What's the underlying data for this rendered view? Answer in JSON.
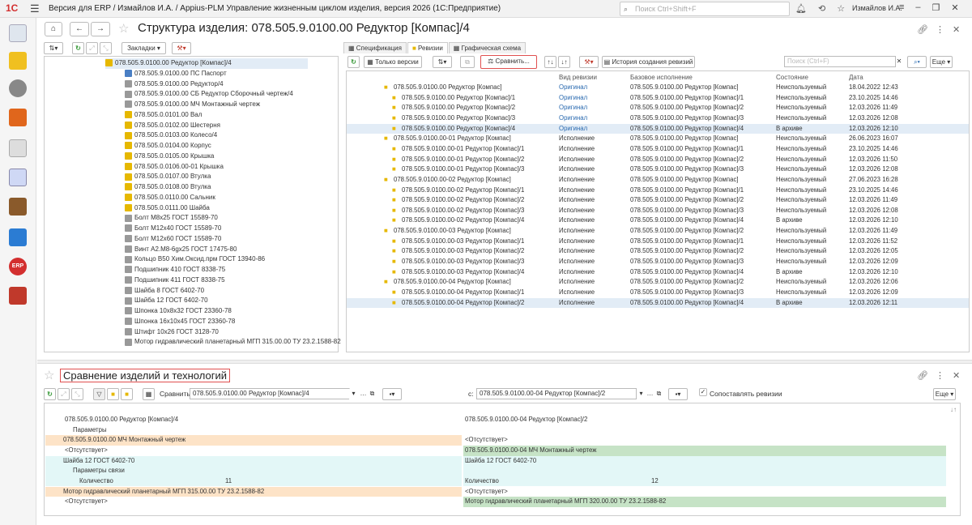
{
  "window": {
    "app_title": "Версия для ERP / Измайлов И.А. / Appius-PLM Управление жизненным циклом изделия, версия 2026  (1С:Предприятие)",
    "search_placeholder": "Поиск Ctrl+Shift+F",
    "user": "Измайлов И.А."
  },
  "main": {
    "title": "Структура изделия: 078.505.9.0100.00 Редуктор [Компас]/4",
    "bookmarks_label": "Закладки",
    "tabs": [
      "Спецификация",
      "Ревизии",
      "Графическая схема"
    ],
    "toolbar": {
      "only_versions": "Только версии",
      "compare": "Сравнить...",
      "history": "История создания ревизий",
      "search_placeholder": "Поиск (Ctrl+F)",
      "more": "Еще"
    },
    "columns": [
      "Вид ревизии",
      "Базовое исполнение",
      "Состояние",
      "Дата"
    ]
  },
  "tree": [
    "078.505.9.0100.00 Редуктор [Компас]/4",
    "078.505.9.0100.00 ПС Паспорт",
    "078.505.9.0100.00 Редуктор/4",
    "078.505.9.0100.00 СБ Редуктор Сборочный чертеж/4",
    "078.505.9.0100.00 МЧ Монтажный чертеж",
    "078.505.0.0101.00 Вал",
    "078.505.0.0102.00 Шестерня",
    "078.505.0.0103.00 Колесо/4",
    "078.505.0.0104.00 Корпус",
    "078.505.0.0105.00 Крышка",
    "078.505.0.0106.00-01 Крышка",
    "078.505.0.0107.00 Втулка",
    "078.505.0.0108.00 Втулка",
    "078.505.0.0110.00 Сальник",
    "078.505.0.0111.00 Шайба",
    "Болт М8x25 ГОСТ 15589-70",
    "Болт М12x40 ГОСТ 15589-70",
    "Болт М12x60 ГОСТ 15589-70",
    "Винт А2.М8-6gx25 ГОСТ 17475-80",
    "Кольцо B50 Хим.Оксид.прм ГОСТ 13940-86",
    "Подшипник 410  ГОСТ 8338-75",
    "Подшипник 411 ГОСТ 8338-75",
    "Шайба 8 ГОСТ 6402-70",
    "Шайба 12 ГОСТ 6402-70",
    "Шпонка 10x8x32 ГОСТ 23360-78",
    "Шпонка 16x10x45 ГОСТ 23360-78",
    "Штифт 10x26 ГОСТ 3128-70",
    "Мотор гидравлический планетарный МГП 315.00.00 ТУ 23.2.1588-82"
  ],
  "revisions": [
    {
      "name": "078.505.9.0100.00 Редуктор [Компас]",
      "kind": "Оригинал",
      "base": "078.505.9.0100.00 Редуктор [Компас]",
      "state": "Неиспользуемый",
      "date": "18.04.2022 12:43"
    },
    {
      "name": "078.505.9.0100.00 Редуктор [Компас]/1",
      "kind": "Оригинал",
      "base": "078.505.9.0100.00 Редуктор [Компас]/1",
      "state": "Неиспользуемый",
      "date": "23.10.2025 14:46"
    },
    {
      "name": "078.505.9.0100.00 Редуктор [Компас]/2",
      "kind": "Оригинал",
      "base": "078.505.9.0100.00 Редуктор [Компас]/2",
      "state": "Неиспользуемый",
      "date": "12.03.2026 11:49"
    },
    {
      "name": "078.505.9.0100.00 Редуктор [Компас]/3",
      "kind": "Оригинал",
      "base": "078.505.9.0100.00 Редуктор [Компас]/3",
      "state": "Неиспользуемый",
      "date": "12.03.2026 12:08"
    },
    {
      "name": "078.505.9.0100.00 Редуктор [Компас]/4",
      "kind": "Оригинал",
      "base": "078.505.9.0100.00 Редуктор [Компас]/4",
      "state": "В архиве",
      "date": "12.03.2026 12:10"
    },
    {
      "name": "078.505.9.0100.00-01 Редуктор [Компас]",
      "kind": "Исполнение",
      "base": "078.505.9.0100.00 Редуктор [Компас]",
      "state": "Неиспользуемый",
      "date": "26.06.2023 16:07"
    },
    {
      "name": "078.505.9.0100.00-01 Редуктор [Компас]/1",
      "kind": "Исполнение",
      "base": "078.505.9.0100.00 Редуктор [Компас]/1",
      "state": "Неиспользуемый",
      "date": "23.10.2025 14:46"
    },
    {
      "name": "078.505.9.0100.00-01 Редуктор [Компас]/2",
      "kind": "Исполнение",
      "base": "078.505.9.0100.00 Редуктор [Компас]/2",
      "state": "Неиспользуемый",
      "date": "12.03.2026 11:50"
    },
    {
      "name": "078.505.9.0100.00-01 Редуктор [Компас]/3",
      "kind": "Исполнение",
      "base": "078.505.9.0100.00 Редуктор [Компас]/3",
      "state": "Неиспользуемый",
      "date": "12.03.2026 12:08"
    },
    {
      "name": "078.505.9.0100.00-02 Редуктор [Компас]",
      "kind": "Исполнение",
      "base": "078.505.9.0100.00 Редуктор [Компас]",
      "state": "Неиспользуемый",
      "date": "27.06.2023 16:28"
    },
    {
      "name": "078.505.9.0100.00-02 Редуктор [Компас]/1",
      "kind": "Исполнение",
      "base": "078.505.9.0100.00 Редуктор [Компас]/1",
      "state": "Неиспользуемый",
      "date": "23.10.2025 14:46"
    },
    {
      "name": "078.505.9.0100.00-02 Редуктор [Компас]/2",
      "kind": "Исполнение",
      "base": "078.505.9.0100.00 Редуктор [Компас]/2",
      "state": "Неиспользуемый",
      "date": "12.03.2026 11:49"
    },
    {
      "name": "078.505.9.0100.00-02 Редуктор [Компас]/3",
      "kind": "Исполнение",
      "base": "078.505.9.0100.00 Редуктор [Компас]/3",
      "state": "Неиспользуемый",
      "date": "12.03.2026 12:08"
    },
    {
      "name": "078.505.9.0100.00-02 Редуктор [Компас]/4",
      "kind": "Исполнение",
      "base": "078.505.9.0100.00 Редуктор [Компас]/4",
      "state": "В архиве",
      "date": "12.03.2026 12:10"
    },
    {
      "name": "078.505.9.0100.00-03 Редуктор [Компас]",
      "kind": "Исполнение",
      "base": "078.505.9.0100.00 Редуктор [Компас]/2",
      "state": "Неиспользуемый",
      "date": "12.03.2026 11:49"
    },
    {
      "name": "078.505.9.0100.00-03 Редуктор [Компас]/1",
      "kind": "Исполнение",
      "base": "078.505.9.0100.00 Редуктор [Компас]/1",
      "state": "Неиспользуемый",
      "date": "12.03.2026 11:52"
    },
    {
      "name": "078.505.9.0100.00-03 Редуктор [Компас]/2",
      "kind": "Исполнение",
      "base": "078.505.9.0100.00 Редуктор [Компас]/2",
      "state": "Неиспользуемый",
      "date": "12.03.2026 12:05"
    },
    {
      "name": "078.505.9.0100.00-03 Редуктор [Компас]/3",
      "kind": "Исполнение",
      "base": "078.505.9.0100.00 Редуктор [Компас]/3",
      "state": "Неиспользуемый",
      "date": "12.03.2026 12:09"
    },
    {
      "name": "078.505.9.0100.00-03 Редуктор [Компас]/4",
      "kind": "Исполнение",
      "base": "078.505.9.0100.00 Редуктор [Компас]/4",
      "state": "В архиве",
      "date": "12.03.2026 12:10"
    },
    {
      "name": "078.505.9.0100.00-04 Редуктор [Компас]",
      "kind": "Исполнение",
      "base": "078.505.9.0100.00 Редуктор [Компас]/2",
      "state": "Неиспользуемый",
      "date": "12.03.2026 12:06"
    },
    {
      "name": "078.505.9.0100.00-04 Редуктор [Компас]/1",
      "kind": "Исполнение",
      "base": "078.505.9.0100.00 Редуктор [Компас]/3",
      "state": "Неиспользуемый",
      "date": "12.03.2026 12:09"
    },
    {
      "name": "078.505.9.0100.00-04 Редуктор [Компас]/2",
      "kind": "Исполнение",
      "base": "078.505.9.0100.00 Редуктор [Компас]/4",
      "state": "В архиве",
      "date": "12.03.2026 12:11"
    }
  ],
  "compare": {
    "title": "Сравнение изделий и технологий",
    "compare_label": "Сравнить:",
    "left_value": "078.505.9.0100.00 Редуктор [Компас]/4",
    "with_label": "с:",
    "right_value": "078.505.9.0100.00-04 Редуктор [Компас]/2",
    "checkbox_label": "Сопоставлять ревизии",
    "more": "Еще",
    "rows": [
      {
        "left": "078.505.9.0100.00 Редуктор [Компас]/4",
        "right": "078.505.9.0100.00-04 Редуктор [Компас]/2",
        "lv": "",
        "rv": ""
      },
      {
        "left": "Параметры",
        "right": "",
        "lv": "",
        "rv": ""
      },
      {
        "left": "078.505.9.0100.00 МЧ Монтажный чертеж",
        "right": "<Отсутствует>",
        "lv": "",
        "rv": ""
      },
      {
        "left": "<Отсутствует>",
        "right": "078.505.9.0100.00-04 МЧ Монтажный чертеж",
        "lv": "",
        "rv": ""
      },
      {
        "left": "Шайба 12 ГОСТ 6402-70",
        "right": "Шайба 12 ГОСТ 6402-70",
        "lv": "",
        "rv": ""
      },
      {
        "left": "Параметры связи",
        "right": "",
        "lv": "",
        "rv": ""
      },
      {
        "left": "Количество",
        "right": "Количество",
        "lv": "11",
        "rv": "12"
      },
      {
        "left": "Мотор гидравлический планетарный МГП 315.00.00 ТУ 23.2.1588-82",
        "right": "<Отсутствует>",
        "lv": "",
        "rv": ""
      },
      {
        "left": "<Отсутствует>",
        "right": "Мотор гидравлический планетарный МГП 320.00.00 ТУ 23.2.1588-82",
        "lv": "",
        "rv": ""
      }
    ]
  }
}
